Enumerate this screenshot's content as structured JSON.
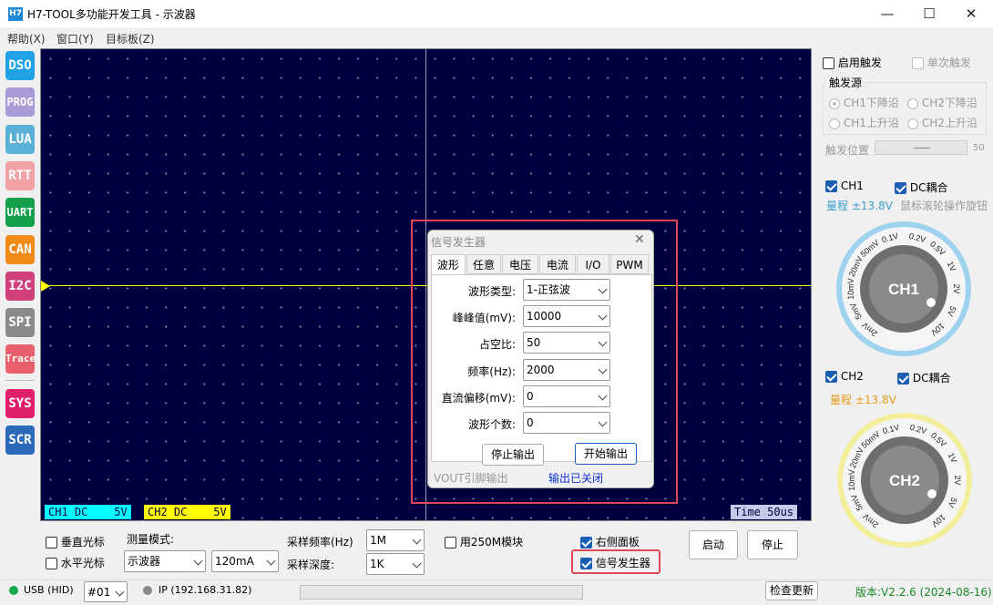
{
  "window": {
    "icon_text": "H7",
    "title": "H7-TOOL多功能开发工具 - 示波器",
    "minimize_glyph": "—",
    "maximize_glyph": "☐",
    "close_glyph": "✕"
  },
  "menu": [
    "帮助(X)",
    "窗口(Y)",
    "目标板(Z)"
  ],
  "sidebar": [
    {
      "label": "DSO",
      "color": "#1fa3e6"
    },
    {
      "label": "PROG",
      "color": "#a99bd6"
    },
    {
      "label": "LUA",
      "color": "#5bb0d8"
    },
    {
      "label": "RTT",
      "color": "#f2a2a6"
    },
    {
      "label": "UART",
      "color": "#14a04a"
    },
    {
      "label": "CAN",
      "color": "#f08a18"
    },
    {
      "label": "I2C",
      "color": "#d0407a"
    },
    {
      "label": "SPI",
      "color": "#8a8a8a"
    },
    {
      "label": "Trace",
      "color": "#e8606e"
    },
    {
      "label": "SYS",
      "color": "#e0206a"
    },
    {
      "label": "SCR",
      "color": "#2a6ab8"
    }
  ],
  "scope": {
    "ch1_label": "CH1 DC    5V",
    "ch2_label": "CH2 DC    5V",
    "time_label": "Time 50us",
    "ch1_color": "#00ffff",
    "ch2_color": "#ffff00",
    "background": "#000040"
  },
  "dialog": {
    "title": "信号发生器",
    "close_glyph": "✕",
    "tabs": [
      "波形",
      "任意",
      "电压",
      "电流",
      "I/O",
      "PWM"
    ],
    "fields": [
      {
        "label": "波形类型:",
        "value": "1-正弦波"
      },
      {
        "label": "峰峰值(mV):",
        "value": "10000"
      },
      {
        "label": "占空比:",
        "value": "50"
      },
      {
        "label": "频率(Hz):",
        "value": "2000"
      },
      {
        "label": "直流偏移(mV):",
        "value": "0"
      },
      {
        "label": "波形个数:",
        "value": "0"
      }
    ],
    "stop_button": "停止输出",
    "start_button": "开始输出",
    "vout_note": "VOUT引脚输出",
    "status": "输出已关闭"
  },
  "right_panel": {
    "enable_trigger": "启用触发",
    "single_trigger": "单次触发",
    "trigger_source_title": "触发源",
    "trigger_options": [
      "CH1下降沿",
      "CH2下降沿",
      "CH1上升沿",
      "CH2上升沿"
    ],
    "trigger_position_label": "触发位置",
    "trigger_position_value": "50",
    "ch1": {
      "name": "CH1",
      "coupling": "DC耦合",
      "range": "量程 ±13.8V",
      "hint": "鼠标滚轮操作旋钮",
      "range_color": "#3aa0d0"
    },
    "ch2": {
      "name": "CH2",
      "coupling": "DC耦合",
      "range": "量程 ±13.8V",
      "range_color": "#e89a1a"
    },
    "dial_ticks": [
      "0.1V",
      "0.2V",
      "0.5V",
      "1V",
      "2V",
      "5V",
      "10V",
      "2mV",
      "5mV",
      "10mV",
      "20mV",
      "50mV"
    ],
    "dial1_ring_color": "#9fd2ee",
    "dial2_ring_color": "#f2ee9a"
  },
  "bottom": {
    "vertical_cursor": "垂直光标",
    "horizontal_cursor": "水平光标",
    "measure_mode_label": "测量模式:",
    "measure_mode_value": "示波器",
    "current_value": "120mA",
    "sample_rate_label": "采样频率(Hz)",
    "sample_rate_value": "1M",
    "sample_depth_label": "采样深度:",
    "sample_depth_value": "1K",
    "use_250m": "用250M模块",
    "right_panel_toggle": "右侧面板",
    "signal_generator_toggle": "信号发生器",
    "start_button": "启动",
    "stop_button": "停止"
  },
  "status": {
    "usb": "USB (HID)",
    "device": "#01",
    "ip": "IP (192.168.31.82)",
    "check_update": "检查更新",
    "version": "版本:V2.2.6 (2024-08-16)"
  }
}
